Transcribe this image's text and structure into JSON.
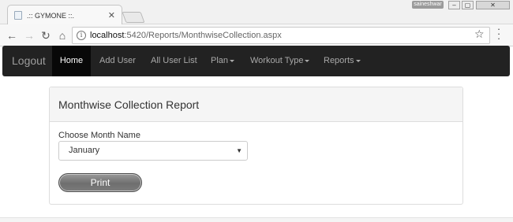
{
  "browser": {
    "tab_title": ".:: GYMONE ::.",
    "user_badge": "saineshwar",
    "url_host": "localhost",
    "url_path": ":5420/Reports/MonthwiseCollection.aspx"
  },
  "navbar": {
    "brand": "Logout",
    "items": [
      {
        "label": "Home",
        "active": true
      },
      {
        "label": "Add User"
      },
      {
        "label": "All User List"
      },
      {
        "label": "Plan"
      },
      {
        "label": "Workout Type"
      },
      {
        "label": "Reports"
      }
    ]
  },
  "panel": {
    "heading": "Monthwise Collection Report",
    "month_label": "Choose Month Name",
    "month_selected": "January",
    "print_label": "Print"
  },
  "icons": {
    "back": "arrow-left-icon",
    "forward": "arrow-right-icon",
    "reload": "reload-icon",
    "home": "home-icon",
    "info": "info-icon",
    "bookmark": "star-icon",
    "menu": "kebab-menu-icon"
  },
  "colors": {
    "navbar_bg": "#222222",
    "navbar_active_bg": "#080808",
    "panel_heading_bg": "#f5f5f5"
  }
}
